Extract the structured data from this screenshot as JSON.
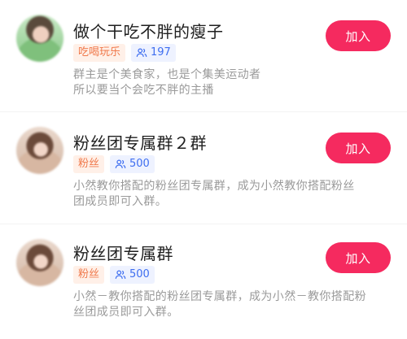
{
  "groups": [
    {
      "name": "做个干吃不胖的瘦子",
      "category_tag": "吃喝玩乐",
      "member_count": "197",
      "description_line1": "群主是个美食家，也是个集美运动者",
      "description_line2": "所以要当个会吃不胖的主播",
      "join_label": "加入",
      "avatar_icon": "avatar-photo"
    },
    {
      "name": "粉丝团专属群２群",
      "category_tag": "粉丝",
      "member_count": "500",
      "description_line1": "小然教你搭配的粉丝团专属群，成为小然教你搭配粉丝",
      "description_line2": "团成员即可入群。",
      "join_label": "加入",
      "avatar_icon": "avatar-photo"
    },
    {
      "name": "粉丝团专属群",
      "category_tag": "粉丝",
      "member_count": "500",
      "description_line1": "小然－教你搭配的粉丝团专属群，成为小然－教你搭配粉",
      "description_line2": "丝团成员即可入群。",
      "join_label": "加入",
      "avatar_icon": "avatar-photo"
    }
  ],
  "colors": {
    "join_button": "#f52a5f",
    "category_tag_text": "#f0784a",
    "category_tag_bg": "#fff0e8",
    "members_tag_text": "#3e6ef0",
    "members_tag_bg": "#eef2ff"
  },
  "icons": {
    "members": "people-icon"
  }
}
